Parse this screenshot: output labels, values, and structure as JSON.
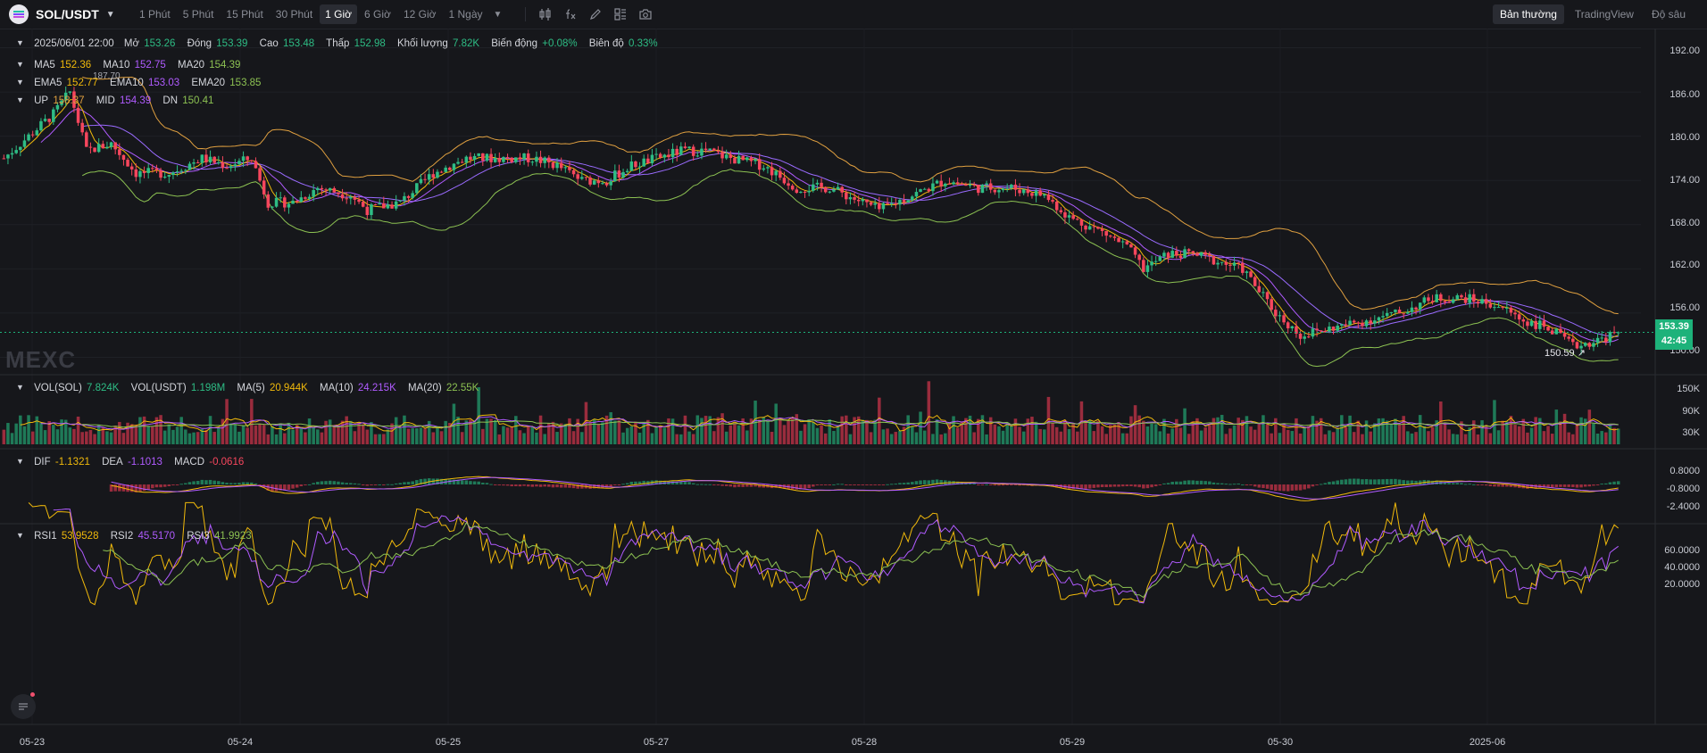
{
  "symbol": {
    "name": "SOL/USDT",
    "caret": "▼"
  },
  "intervals": [
    "1 Phút",
    "5 Phút",
    "15 Phút",
    "30 Phút",
    "1 Giờ",
    "6 Giờ",
    "12 Giờ",
    "1 Ngày"
  ],
  "active_interval": "1 Giờ",
  "toolbar_icons": [
    "candlestick-type-icon",
    "indicator-fx-icon",
    "drawing-pen-icon",
    "layout-grid-icon",
    "camera-icon"
  ],
  "views": [
    "Bản thường",
    "TradingView",
    "Độ sâu"
  ],
  "active_view": "Bản thường",
  "info": {
    "datetime": "2025/06/01 22:00",
    "open_label": "Mở",
    "open": "153.26",
    "close_label": "Đóng",
    "close": "153.39",
    "high_label": "Cao",
    "high": "153.48",
    "low_label": "Thấp",
    "low": "152.98",
    "volume_label": "Khối lượng",
    "volume": "7.82K",
    "change_label": "Biến động",
    "change": "+0.08%",
    "amplitude_label": "Biên độ",
    "amplitude": "0.33%"
  },
  "ma": {
    "ma5_label": "MA5",
    "ma5": "152.36",
    "ma10_label": "MA10",
    "ma10": "152.75",
    "ma20_label": "MA20",
    "ma20": "154.39"
  },
  "ema": {
    "ema5_label": "EMA5",
    "ema5": "152.77",
    "ema10_label": "EMA10",
    "ema10": "153.03",
    "ema20_label": "EMA20",
    "ema20": "153.85"
  },
  "boll": {
    "up_label": "UP",
    "up": "158.37",
    "mid_label": "MID",
    "mid": "154.39",
    "dn_label": "DN",
    "dn": "150.41"
  },
  "vol": {
    "vol_sol_label": "VOL(SOL)",
    "vol_sol": "7.824K",
    "vol_usdt_label": "VOL(USDT)",
    "vol_usdt": "1.198M",
    "ma5_label": "MA(5)",
    "ma5": "20.944K",
    "ma10_label": "MA(10)",
    "ma10": "24.215K",
    "ma20_label": "MA(20)",
    "ma20": "22.55K"
  },
  "macd": {
    "dif_label": "DIF",
    "dif": "-1.1321",
    "dea_label": "DEA",
    "dea": "-1.1013",
    "macd_label": "MACD",
    "macd": "-0.0616"
  },
  "rsi": {
    "rsi1_label": "RSI1",
    "rsi1": "53.9528",
    "rsi2_label": "RSI2",
    "rsi2": "45.5170",
    "rsi3_label": "RSI3",
    "rsi3": "41.9923"
  },
  "price_axis": [
    "192.00",
    "186.00",
    "180.00",
    "174.00",
    "168.00",
    "162.00",
    "156.00",
    "150.00"
  ],
  "vol_axis": [
    "150K",
    "90K",
    "30K"
  ],
  "macd_axis": [
    "0.8000",
    "-0.8000",
    "-2.4000"
  ],
  "rsi_axis": [
    "60.0000",
    "40.0000",
    "20.0000"
  ],
  "x_axis": [
    "05-23",
    "05-24",
    "05-25",
    "05-27",
    "05-28",
    "05-29",
    "05-30",
    "2025-06"
  ],
  "last_price": "153.39",
  "countdown": "42:45",
  "low_marker": "150.59",
  "high_marker": "187.70",
  "watermark": "MEXC",
  "colors": {
    "up": "#2ebd85",
    "down": "#f6465d",
    "ma5": "#f0b90b",
    "ma10": "#b05bff",
    "ma20": "#8cc152",
    "boll_up": "#e0a040",
    "last_price": "#1db27a"
  },
  "chart_data": {
    "type": "candlestick",
    "x_axis_ticks": [
      "05-23",
      "05-24",
      "05-25",
      "05-27",
      "05-28",
      "05-29",
      "05-30",
      "2025-06"
    ],
    "y_range": [
      148,
      194
    ],
    "anchor_path": [
      [
        0,
        177
      ],
      [
        6,
        180
      ],
      [
        12,
        183
      ],
      [
        16,
        186
      ],
      [
        20,
        178
      ],
      [
        26,
        179
      ],
      [
        32,
        175
      ],
      [
        40,
        175
      ],
      [
        48,
        177
      ],
      [
        54,
        176
      ],
      [
        60,
        177
      ],
      [
        64,
        171
      ],
      [
        70,
        171
      ],
      [
        76,
        173
      ],
      [
        84,
        172
      ],
      [
        88,
        170
      ],
      [
        96,
        171
      ],
      [
        104,
        175
      ],
      [
        112,
        177
      ],
      [
        120,
        177
      ],
      [
        128,
        177
      ],
      [
        134,
        176
      ],
      [
        140,
        174
      ],
      [
        146,
        174
      ],
      [
        152,
        176
      ],
      [
        158,
        177
      ],
      [
        164,
        178
      ],
      [
        170,
        178
      ],
      [
        176,
        177
      ],
      [
        184,
        176
      ],
      [
        192,
        173
      ],
      [
        200,
        173
      ],
      [
        208,
        171
      ],
      [
        212,
        170
      ],
      [
        220,
        172
      ],
      [
        228,
        174
      ],
      [
        236,
        173
      ],
      [
        244,
        173
      ],
      [
        252,
        172
      ],
      [
        258,
        169
      ],
      [
        266,
        167
      ],
      [
        272,
        165
      ],
      [
        276,
        162
      ],
      [
        282,
        164
      ],
      [
        288,
        164
      ],
      [
        294,
        163
      ],
      [
        300,
        162
      ],
      [
        304,
        159
      ],
      [
        308,
        156
      ],
      [
        314,
        153
      ],
      [
        322,
        154
      ],
      [
        330,
        155
      ],
      [
        338,
        156
      ],
      [
        346,
        158
      ],
      [
        354,
        158
      ],
      [
        362,
        157
      ],
      [
        368,
        155
      ],
      [
        374,
        154
      ],
      [
        380,
        151.5
      ],
      [
        386,
        152.3
      ],
      [
        391,
        153.39
      ]
    ],
    "n_candles": 392,
    "last_close": 153.39,
    "indicators": [
      "MA5",
      "MA10",
      "MA20",
      "EMA5",
      "EMA10",
      "EMA20",
      "BOLL"
    ]
  }
}
